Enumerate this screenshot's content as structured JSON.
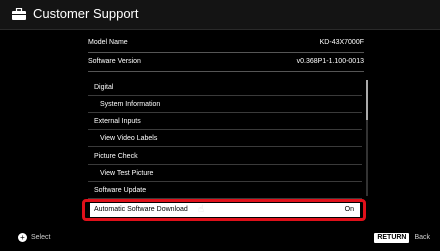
{
  "header": {
    "title": "Customer Support",
    "icon": "briefcase-icon"
  },
  "info": {
    "model_label": "Model Name",
    "model_value": "KD-43X7000F",
    "software_label": "Software Version",
    "software_value": "v0.368P1-1.100-0013"
  },
  "menu": {
    "items": [
      {
        "label": "Digital"
      },
      {
        "label": "System Information"
      },
      {
        "label": "External Inputs"
      },
      {
        "label": "View Video Labels"
      },
      {
        "label": "Picture Check"
      },
      {
        "label": "View Test Picture"
      },
      {
        "label": "Software Update"
      }
    ],
    "focused": {
      "label": "Automatic Software Download",
      "value": "On"
    }
  },
  "footer": {
    "select_label": "Select",
    "return_label": "RETURN",
    "back_label": "Back"
  },
  "colors": {
    "highlight": "#e0101a",
    "background": "#000000",
    "focus_bg": "#ffffff"
  }
}
